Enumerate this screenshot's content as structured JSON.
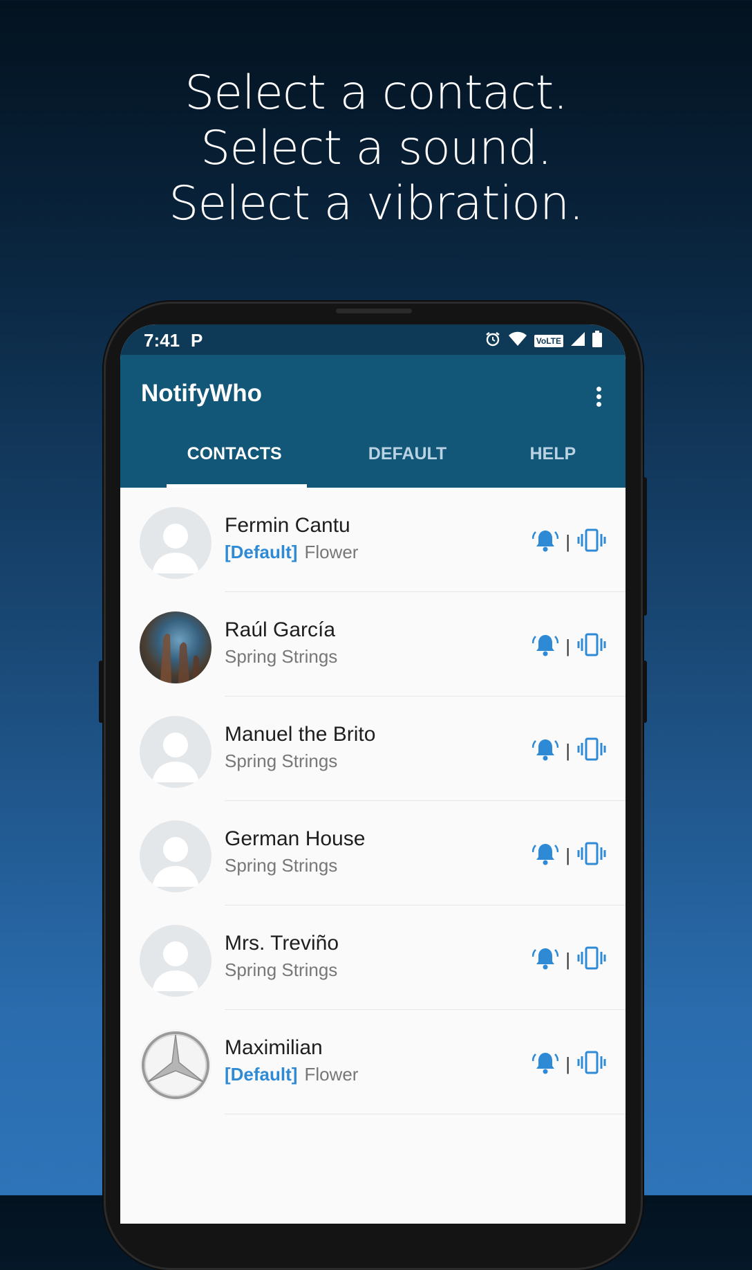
{
  "headline": {
    "line1": "Select a contact.",
    "line2": "Select a sound.",
    "line3": "Select a vibration."
  },
  "status_bar": {
    "time": "7:41",
    "app_indicator": "P",
    "network_badge": "VoLTE",
    "icons": [
      "alarm-icon",
      "wifi-icon",
      "signal-icon",
      "battery-icon"
    ]
  },
  "app": {
    "title": "NotifyWho",
    "menu_icon": "more-vert-icon"
  },
  "tabs": [
    {
      "label": "CONTACTS",
      "active": true
    },
    {
      "label": "DEFAULT",
      "active": false
    },
    {
      "label": "HELP",
      "active": false
    }
  ],
  "colors": {
    "primary_dark": "#0e3a58",
    "primary": "#125678",
    "accent": "#2f8ad6"
  },
  "contacts": [
    {
      "name": "Fermin Cantu",
      "tag": "[Default]",
      "sound": "Flower",
      "avatar": "default-avatar"
    },
    {
      "name": "Raúl García",
      "tag": "",
      "sound": "Spring Strings",
      "avatar": "nebula-photo"
    },
    {
      "name": "Manuel the Brito",
      "tag": "",
      "sound": "Spring Strings",
      "avatar": "default-avatar"
    },
    {
      "name": "German House",
      "tag": "",
      "sound": "Spring Strings",
      "avatar": "default-avatar"
    },
    {
      "name": "Mrs. Treviño",
      "tag": "",
      "sound": "Spring Strings",
      "avatar": "default-avatar"
    },
    {
      "name": "Maximilian",
      "tag": "[Default]",
      "sound": "Flower",
      "avatar": "star-logo"
    }
  ],
  "row_actions": {
    "sound_icon": "ringing-bell-icon",
    "separator": "|",
    "vibration_icon": "vibration-icon"
  }
}
